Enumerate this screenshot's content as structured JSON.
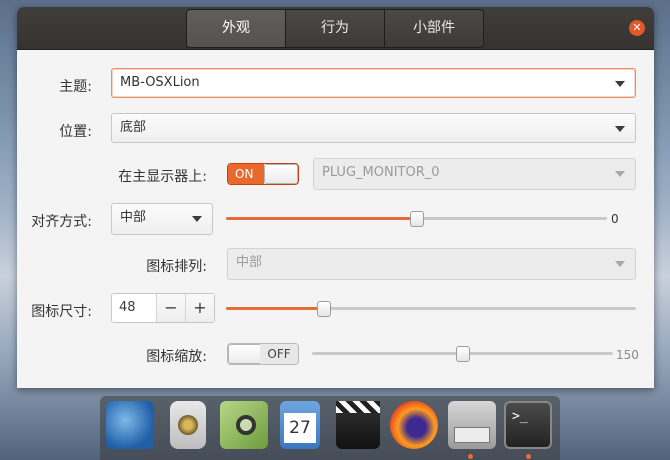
{
  "tabs": [
    "外观",
    "行为",
    "小部件"
  ],
  "labels": {
    "theme": "主题:",
    "position": "位置:",
    "on_primary": "在主显示器上:",
    "alignment": "对齐方式:",
    "icon_arrangement": "图标排列:",
    "icon_size": "图标尺寸:",
    "icon_zoom": "图标缩放:"
  },
  "theme": {
    "value": "MB-OSXLion"
  },
  "position": {
    "value": "底部"
  },
  "primary_switch": {
    "label": "ON",
    "state": true
  },
  "monitor": {
    "value": "PLUG_MONITOR_0"
  },
  "alignment": {
    "value": "中部"
  },
  "offset_slider": {
    "value": 0,
    "fraction": 0.5,
    "label": "0"
  },
  "icon_arrangement": {
    "value": "中部"
  },
  "icon_size": {
    "value": "48",
    "minus": "−",
    "plus": "+",
    "fraction": 0.24
  },
  "zoom_switch": {
    "label": "OFF",
    "state": false
  },
  "zoom_slider": {
    "value": 150,
    "fraction": 0.5,
    "label": "150"
  },
  "colors": {
    "accent": "#e9692c",
    "titlebar": "#3a3936"
  },
  "dock": [
    "thunderbird-icon",
    "speaker-icon",
    "image-viewer-icon",
    "calendar-icon",
    "video-editor-icon",
    "firefox-icon",
    "file-cabinet-icon",
    "terminal-icon"
  ],
  "dock_calendar_day": "27"
}
